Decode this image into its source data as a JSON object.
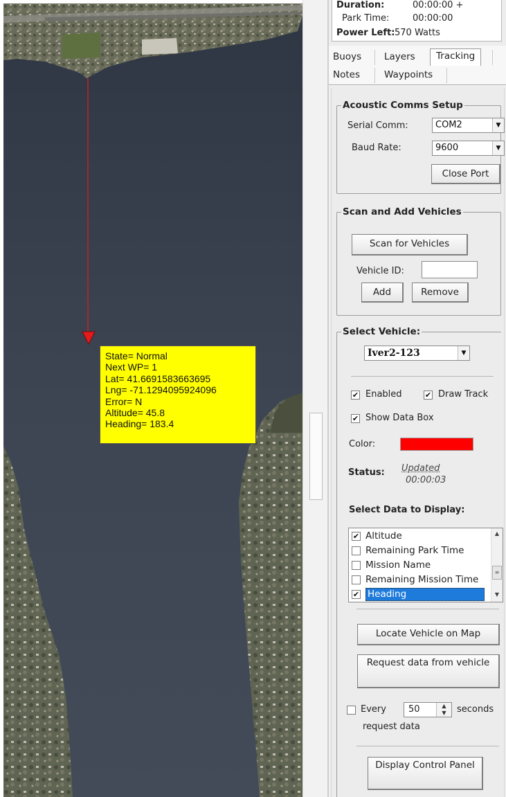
{
  "vehicle_data_box": {
    "lines": [
      "State= Normal",
      "Next WP= 1",
      "Lat= 41.6691583663695",
      "Lng= -71.1294095924096",
      "Error= N",
      "Altitude= 45.8",
      "Heading= 183.4"
    ]
  },
  "info": {
    "duration_label": "Duration:",
    "duration_value": "00:00:00 +",
    "park_time_label": "Park Time:",
    "park_time_value": "00:00:00",
    "power_left_label": "Power Left:",
    "power_left_value": "570 Watts"
  },
  "tabs": [
    {
      "label": "Buoys"
    },
    {
      "label": "Layers"
    },
    {
      "label": "Tracking",
      "active": true
    },
    {
      "label": "Notes"
    },
    {
      "label": "Waypoints"
    }
  ],
  "acoustic_comms": {
    "legend": "Acoustic Comms Setup",
    "serial_comm_label": "Serial Comm:",
    "serial_comm_value": "COM2",
    "baud_rate_label": "Baud Rate:",
    "baud_rate_value": "9600",
    "close_port_button": "Close Port"
  },
  "scan_add": {
    "legend": "Scan and Add Vehicles",
    "scan_button": "Scan for Vehicles",
    "vehicle_id_label": "Vehicle ID:",
    "vehicle_id_value": "",
    "add_button": "Add",
    "remove_button": "Remove"
  },
  "select_vehicle": {
    "legend": "Select Vehicle:",
    "selected": "Iver2-123",
    "enabled_label": "Enabled",
    "enabled_checked": true,
    "draw_track_label": "Draw Track",
    "draw_track_checked": true,
    "show_data_box_label": "Show Data Box",
    "show_data_box_checked": true,
    "color_label": "Color:",
    "track_color": "#ff0000",
    "status_label": "Status:",
    "status_line1": "Updated",
    "status_line2": "00:00:03",
    "select_data_label": "Select Data to Display:",
    "data_items": [
      {
        "label": "Altitude",
        "checked": true
      },
      {
        "label": "Remaining Park Time",
        "checked": false
      },
      {
        "label": "Mission Name",
        "checked": false
      },
      {
        "label": "Remaining Mission Time",
        "checked": false
      },
      {
        "label": "Heading",
        "checked": true,
        "selected": true
      }
    ],
    "locate_button": "Locate Vehicle on Map",
    "request_button": "Request data from vehicle",
    "every_label": "Every",
    "every_checked": false,
    "every_value": "50",
    "seconds_label": "seconds",
    "request_data_label": "request data",
    "display_control_button": "Display Control Panel"
  },
  "colors": {
    "track_line": "#d0201f",
    "data_box_bg": "#ffff00",
    "water": "#3d4553",
    "selection": "#1e7bdc"
  }
}
